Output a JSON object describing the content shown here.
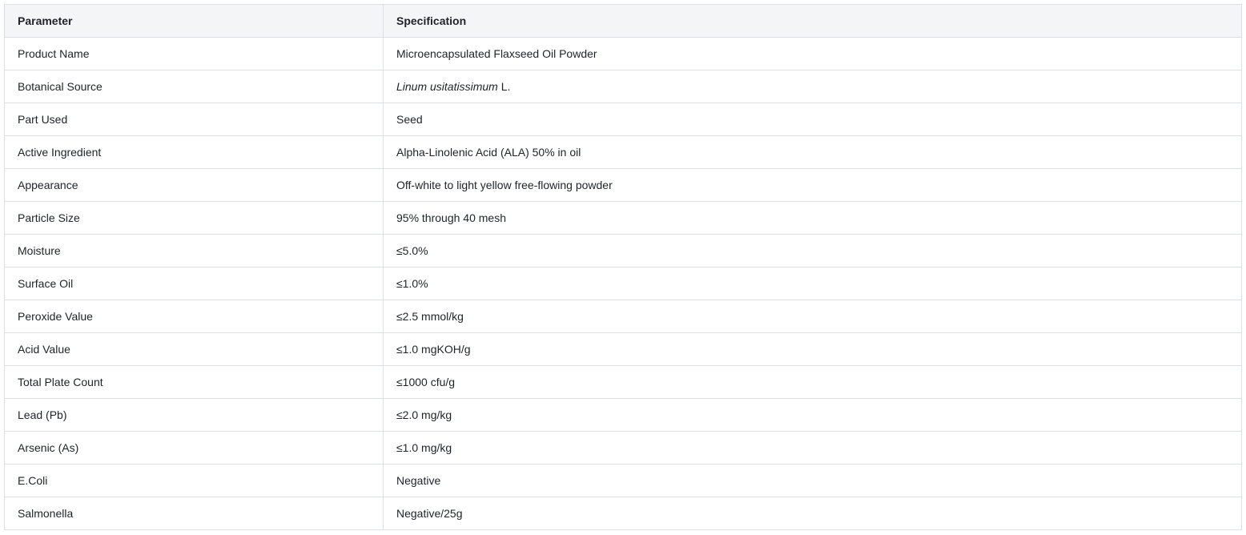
{
  "table": {
    "headers": [
      "Parameter",
      "Specification"
    ],
    "rows": [
      {
        "parameter": "Product Name",
        "specification": "Microencapsulated Flaxseed Oil Powder"
      },
      {
        "parameter": "Botanical Source",
        "specification_italic": "Linum usitatissimum",
        "specification_suffix": " L."
      },
      {
        "parameter": "Part Used",
        "specification": "Seed"
      },
      {
        "parameter": "Active Ingredient",
        "specification": "Alpha-Linolenic Acid (ALA) 50% in oil"
      },
      {
        "parameter": "Appearance",
        "specification": "Off-white to light yellow free-flowing powder"
      },
      {
        "parameter": "Particle Size",
        "specification": "95% through 40 mesh"
      },
      {
        "parameter": "Moisture",
        "specification": "≤5.0%"
      },
      {
        "parameter": "Surface Oil",
        "specification": "≤1.0%"
      },
      {
        "parameter": "Peroxide Value",
        "specification": "≤2.5 mmol/kg"
      },
      {
        "parameter": "Acid Value",
        "specification": "≤1.0 mgKOH/g"
      },
      {
        "parameter": "Total Plate Count",
        "specification": "≤1000 cfu/g"
      },
      {
        "parameter": "Lead (Pb)",
        "specification": "≤2.0 mg/kg"
      },
      {
        "parameter": "Arsenic (As)",
        "specification": "≤1.0 mg/kg"
      },
      {
        "parameter": "E.Coli",
        "specification": "Negative"
      },
      {
        "parameter": "Salmonella",
        "specification": "Negative/25g"
      }
    ]
  }
}
